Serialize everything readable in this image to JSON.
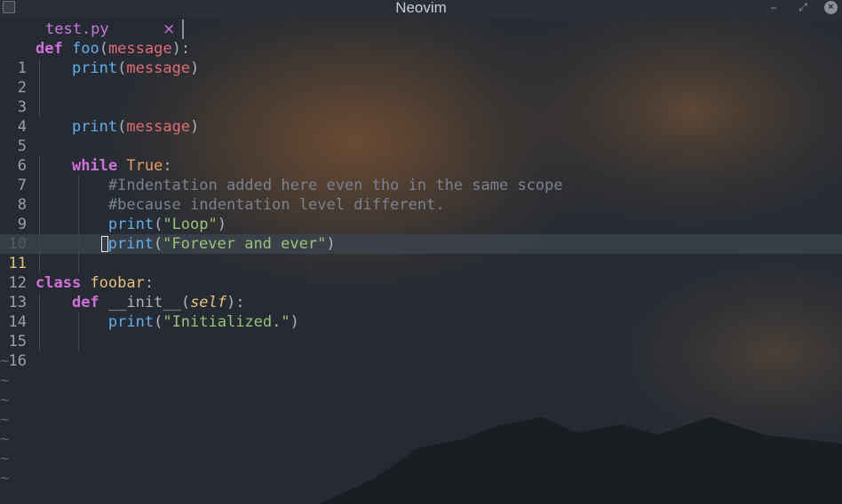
{
  "window": {
    "title": "Neovim",
    "minimize_glyph": "‒",
    "maximize_glyph": "⤢",
    "close_glyph": "×",
    "icon": "neovim-logo-icon"
  },
  "tabline": {
    "tab_label": "test.py",
    "tab_close": "×"
  },
  "editor": {
    "current_line": 11,
    "tilde": "~",
    "lines": [
      {
        "n": "1"
      },
      {
        "n": "2"
      },
      {
        "n": "3"
      },
      {
        "n": "4"
      },
      {
        "n": "5"
      },
      {
        "n": "6"
      },
      {
        "n": "7"
      },
      {
        "n": "8"
      },
      {
        "n": "9"
      },
      {
        "n": "10"
      },
      {
        "n": "11"
      },
      {
        "n": "12"
      },
      {
        "n": "13"
      },
      {
        "n": "14"
      },
      {
        "n": "15"
      },
      {
        "n": "16"
      }
    ],
    "tokens": {
      "l1": [
        "def",
        "foo",
        "(",
        "message",
        "):"
      ],
      "l2": [
        "print",
        "(",
        "message",
        ")"
      ],
      "l5": [
        "print",
        "(",
        "message",
        ")"
      ],
      "l7": [
        "while",
        "True",
        ":"
      ],
      "l8": [
        "#Indentation added here even tho in the same scope"
      ],
      "l9": [
        "#because indentation level different."
      ],
      "l10": [
        "print",
        "(",
        "\"Loop\"",
        ")"
      ],
      "l11": [
        "print",
        "(",
        "\"Forever and ever\"",
        ")"
      ],
      "l13": [
        "class",
        "foobar",
        ":"
      ],
      "l14": [
        "def",
        "__init__",
        "(",
        "self",
        "):"
      ],
      "l15": [
        "print",
        "(",
        "\"Initialized.\"",
        ")"
      ]
    }
  },
  "colors": {
    "keyword": "#d070d8",
    "function": "#61afef",
    "parameter": "#e06c75",
    "string": "#98c379",
    "constant": "#e5a06a",
    "comment": "#7a8290",
    "class_name": "#e5c07b",
    "tab_accent": "#c678dd",
    "current_line_number": "#e5c07b"
  }
}
